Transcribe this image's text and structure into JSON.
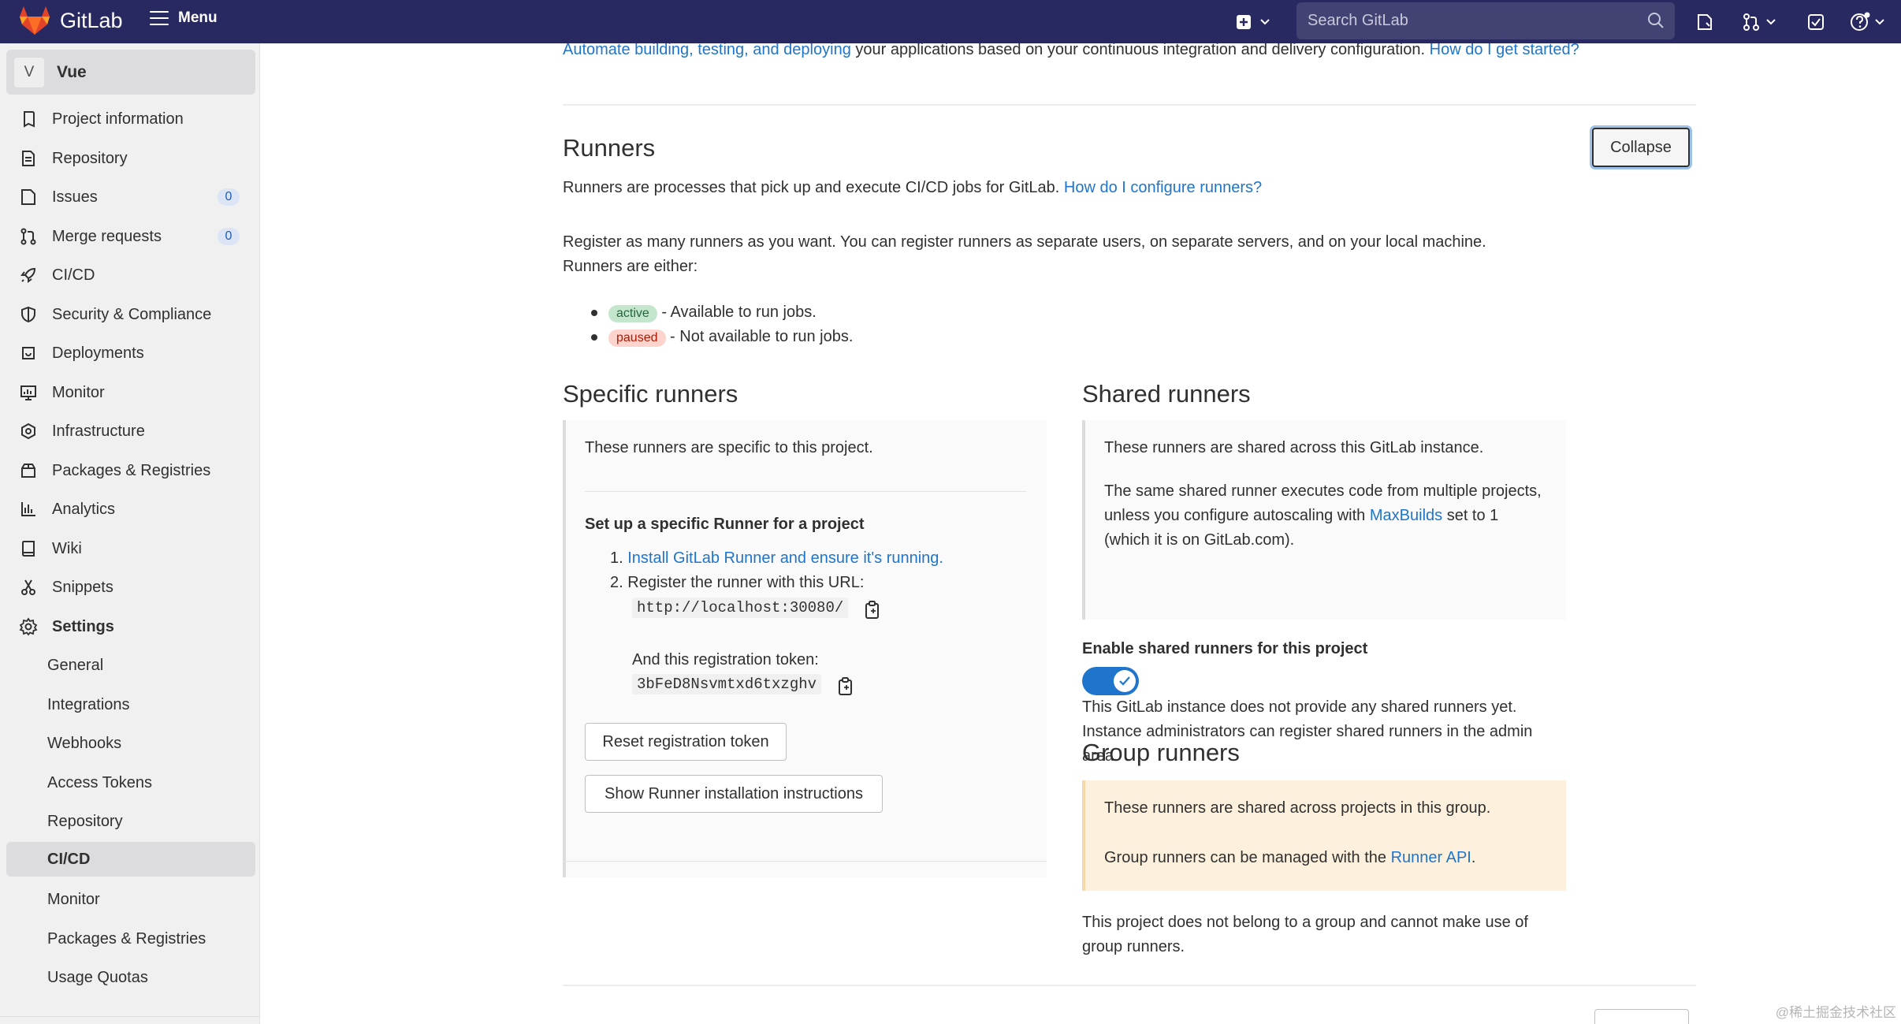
{
  "topbar": {
    "brand": "GitLab",
    "menu_label": "Menu",
    "search_placeholder": "Search GitLab"
  },
  "sidebar": {
    "project_avatar": "V",
    "project_name": "Vue",
    "items": [
      {
        "label": "Project information",
        "icon": "info-icon"
      },
      {
        "label": "Repository",
        "icon": "doc-icon"
      },
      {
        "label": "Issues",
        "icon": "issues-icon",
        "badge": "0"
      },
      {
        "label": "Merge requests",
        "icon": "merge-request-icon",
        "badge": "0"
      },
      {
        "label": "CI/CD",
        "icon": "rocket-icon"
      },
      {
        "label": "Security & Compliance",
        "icon": "shield-icon"
      },
      {
        "label": "Deployments",
        "icon": "deployments-icon"
      },
      {
        "label": "Monitor",
        "icon": "monitor-icon"
      },
      {
        "label": "Infrastructure",
        "icon": "infrastructure-icon"
      },
      {
        "label": "Packages & Registries",
        "icon": "package-icon"
      },
      {
        "label": "Analytics",
        "icon": "chart-icon"
      },
      {
        "label": "Wiki",
        "icon": "book-icon"
      },
      {
        "label": "Snippets",
        "icon": "scissors-icon"
      },
      {
        "label": "Settings",
        "icon": "gear-icon"
      }
    ],
    "settings_sub": [
      "General",
      "Integrations",
      "Webhooks",
      "Access Tokens",
      "Repository",
      "CI/CD",
      "Monitor",
      "Packages & Registries",
      "Usage Quotas"
    ]
  },
  "main": {
    "intro_link": "Automate building, testing, and deploying",
    "intro_text": " your applications based on your continuous integration and delivery configuration. ",
    "intro_help": "How do I get started?",
    "runners_title": "Runners",
    "collapse_label": "Collapse",
    "runners_desc": "Runners are processes that pick up and execute CI/CD jobs for GitLab. ",
    "runners_help": "How do I configure runners?",
    "register_text": "Register as many runners as you want. You can register runners as separate users, on separate servers, and on your local machine.",
    "runners_either": "Runners are either:",
    "state_active": "active",
    "state_active_desc": " - Available to run jobs.",
    "state_paused": "paused",
    "state_paused_desc": " - Not available to run jobs.",
    "specific": {
      "title": "Specific runners",
      "desc": "These runners are specific to this project.",
      "setup_title": "Set up a specific Runner for a project",
      "step1_prefix": "1.",
      "step1_link": "Install GitLab Runner and ensure it's running.",
      "step2_prefix": "2.",
      "step2_text": "Register the runner with this URL:",
      "url": "http://localhost:30080/",
      "token_label": "And this registration token:",
      "token": "3bFeD8Nsvmtxd6txzghv",
      "reset_button": "Reset registration token",
      "install_button": "Show Runner installation instructions"
    },
    "shared": {
      "title": "Shared runners",
      "desc": "These runners are shared across this GitLab instance.",
      "desc2_a": "The same shared runner executes code from multiple projects, unless you configure autoscaling with ",
      "desc2_link": "MaxBuilds",
      "desc2_b": " set to 1 (which it is on GitLab.com).",
      "enable_label": "Enable shared runners for this project",
      "none_text": "This GitLab instance does not provide any shared runners yet. Instance administrators can register shared runners in the admin area."
    },
    "group": {
      "title": "Group runners",
      "desc": "These runners are shared across projects in this group.",
      "manage_a": "Group runners can be managed with the ",
      "manage_link": "Runner API",
      "manage_b": ".",
      "note": "This project does not belong to a group and cannot make use of group runners."
    },
    "watermark": "@稀土掘金技术社区"
  },
  "colors": {
    "navbar": "#292961",
    "link": "#1f75cb",
    "toggle": "#1f75cb"
  }
}
